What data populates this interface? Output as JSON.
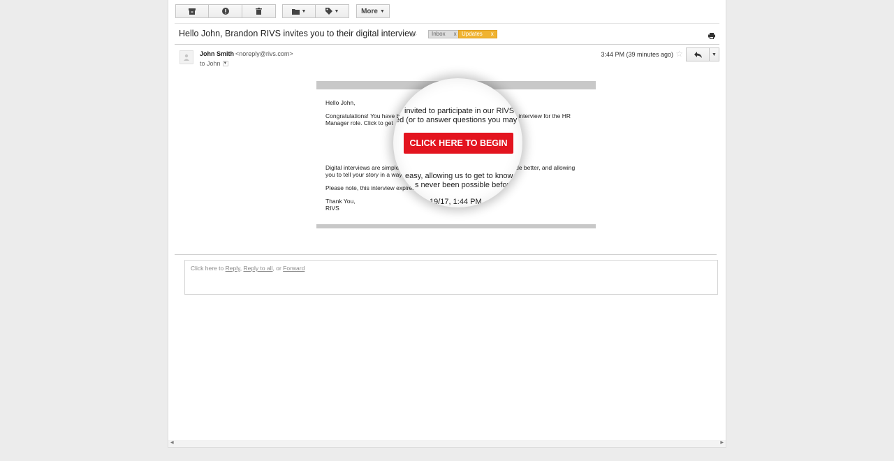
{
  "toolbar": {
    "archive_icon": "archive-icon",
    "spam_icon": "report-spam-icon",
    "delete_icon": "trash-icon",
    "move_icon": "folder-icon",
    "labels_icon": "tag-icon",
    "more_label": "More"
  },
  "email": {
    "subject": "Hello John, Brandon RIVS invites you to their digital interview",
    "labels": [
      {
        "name": "Inbox",
        "close": "x",
        "color": "#dddddd"
      },
      {
        "name": "Updates",
        "close": "x",
        "color": "#f0b330"
      }
    ],
    "sender_name": "John Smith",
    "sender_email": "<noreply@rivs.com>",
    "to": "to John",
    "time": "3:44 PM (39 minutes ago)",
    "star": "☆"
  },
  "body": {
    "greeting": "Hello John,",
    "para1_line1": "Congratulations! You have b",
    "para1_line1_end": "interview for the HR",
    "para1_line2": "Manager role. Click to get",
    "para2_line1": "Digital interviews are simple",
    "para2_line1_end": "ittle better, and allowing",
    "para2_line2": "you to tell your story in a way",
    "para3": "Please note, this interview expires",
    "closing1": "Thank You,",
    "closing2": "RIVS"
  },
  "magnifier": {
    "line1": "invited to participate in our RIVS d",
    "line2": "ed (or to answer questions you may h",
    "cta": "CLICK HERE TO BEGIN",
    "line3": "easy, allowing us to get to know y",
    "line4": "s never been possible before.",
    "line5": "19/17, 1:44 PM"
  },
  "reply": {
    "prefix": "Click here to ",
    "reply": "Reply",
    "sep1": ", ",
    "reply_all": "Reply to all",
    "sep2": ", or ",
    "forward": "Forward"
  },
  "colors": {
    "cta": "#e3141f",
    "updates_label": "#f0b330"
  }
}
